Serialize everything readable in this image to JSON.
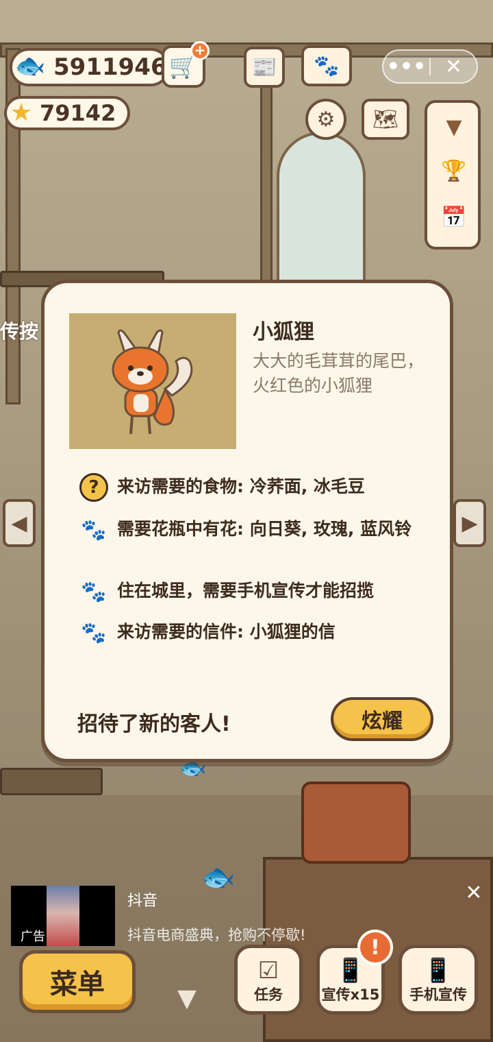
{
  "hud": {
    "coins": "5911946",
    "stars": "79142",
    "edge_label": "传按"
  },
  "topbar": {
    "more_label": "•••",
    "close_label": "✕"
  },
  "guest": {
    "name": "小狐狸",
    "description": "大大的毛茸茸的尾巴，火红色的小狐狸",
    "requirements": [
      {
        "icon": "question-icon",
        "text": "来访需要的食物: 冷荞面, 冰毛豆"
      },
      {
        "icon": "paw-icon",
        "text": "需要花瓶中有花: 向日葵, 玫瑰, 蓝风铃"
      },
      {
        "icon": "paw-icon",
        "text": "住在城里，需要手机宣传才能招揽"
      },
      {
        "icon": "paw-icon",
        "text": "来访需要的信件: 小狐狸的信"
      }
    ],
    "footer_message": "招待了新的客人!",
    "show_button": "炫耀"
  },
  "ad": {
    "source": "抖音",
    "label": "广告",
    "text": "抖音电商盛典，抢购不停歇!"
  },
  "bottom_bar": {
    "menu": "菜单",
    "tasks": "任务",
    "promo_count": "宣传x15",
    "phone_promo": "手机宣传"
  },
  "colors": {
    "accent": "#f5c24a",
    "border": "#6b4f3a",
    "panel": "#fdf6ea",
    "portrait_bg": "#c6ad72",
    "fox_orange": "#e8742e"
  }
}
